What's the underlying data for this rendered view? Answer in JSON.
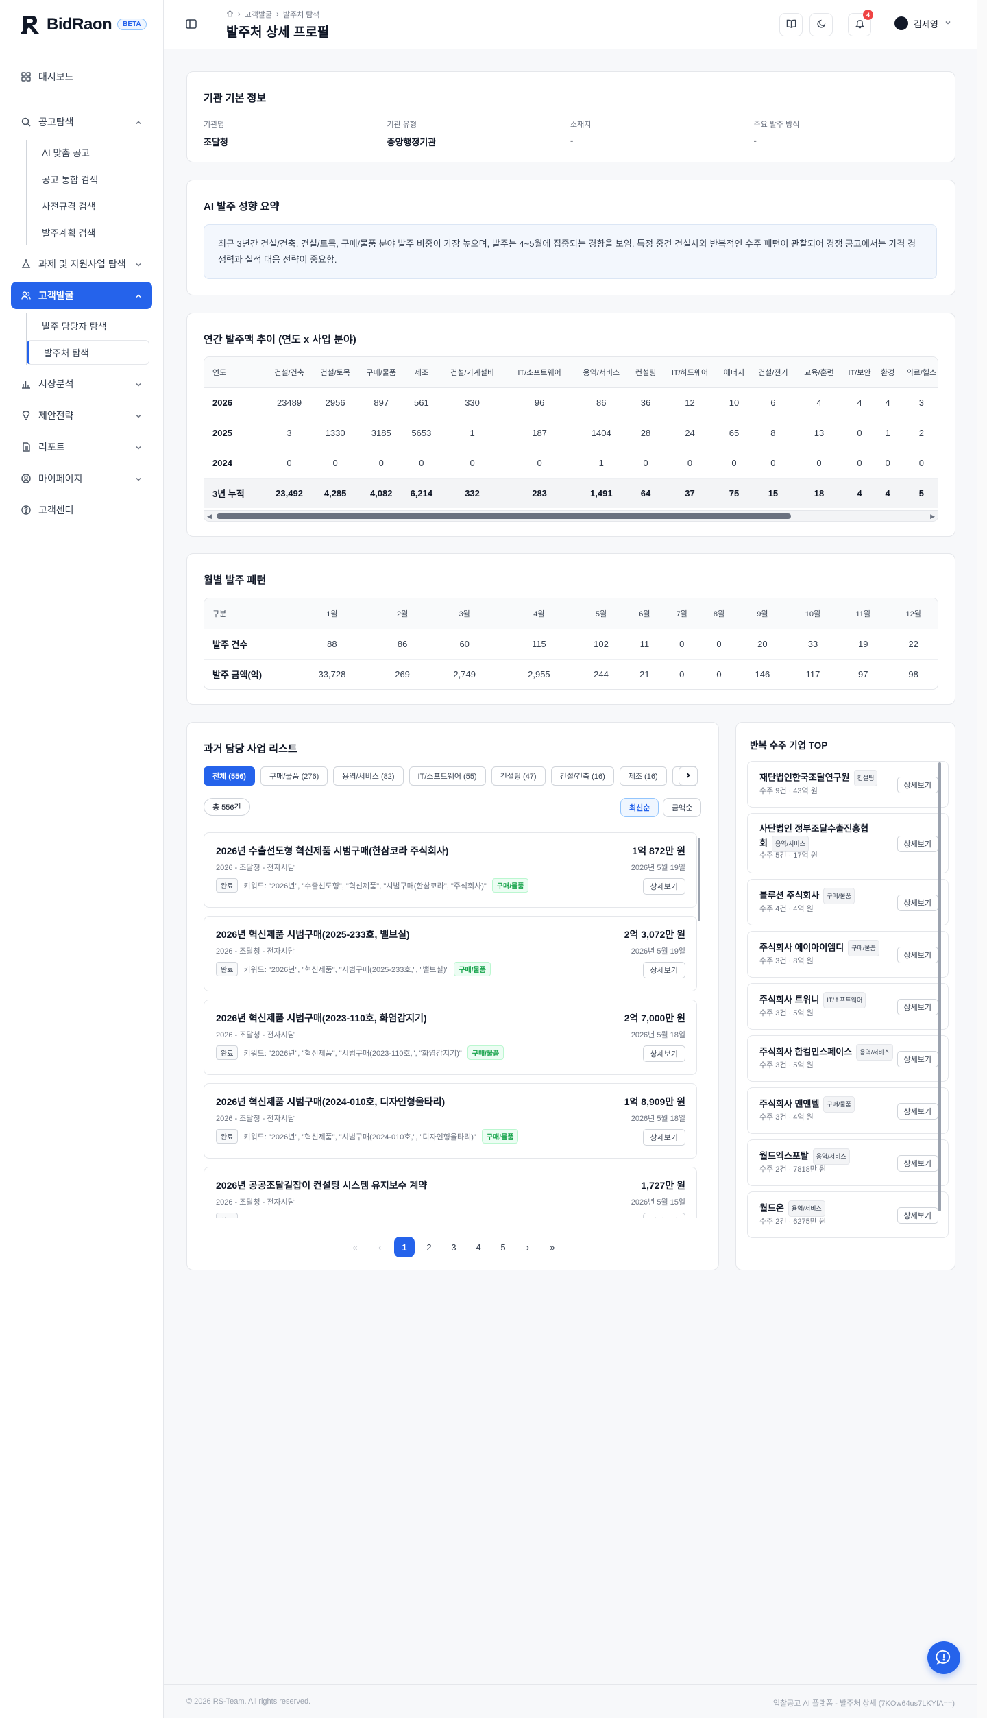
{
  "brand": {
    "name": "BidRaon",
    "badge": "BETA"
  },
  "sidebar": {
    "dashboard": "대시보드",
    "notice": "공고탐색",
    "notice_sub": [
      "AI 맞춤 공고",
      "공고 통합 검색",
      "사전규격 검색",
      "발주계획 검색"
    ],
    "grant": "과제 및 지원사업 탐색",
    "customer": "고객발굴",
    "customer_sub": [
      "발주 담당자 탐색",
      "발주처 탐색"
    ],
    "market": "시장분석",
    "proposal": "제안전략",
    "report": "리포트",
    "mypage": "마이페이지",
    "support": "고객센터"
  },
  "header": {
    "breadcrumb": [
      "고객발굴",
      "발주처 탐색"
    ],
    "title": "발주처 상세 프로필",
    "notif_count": "4",
    "user": "김세영"
  },
  "basic_info": {
    "title": "기관 기본 정보",
    "fields": [
      {
        "label": "기관명",
        "value": "조달청"
      },
      {
        "label": "기관 유형",
        "value": "중앙행정기관"
      },
      {
        "label": "소재지",
        "value": "-"
      },
      {
        "label": "주요 발주 방식",
        "value": "-"
      }
    ]
  },
  "ai_summary": {
    "title": "AI 발주 성향 요약",
    "text": "최근 3년간 건설/건축, 건설/토목, 구매/물품 분야 발주 비중이 가장 높으며, 발주는 4~5월에 집중되는 경향을 보임. 특정 중견 건설사와 반복적인 수주 패턴이 관찰되어 경쟁 공고에서는 가격 경쟁력과 실적 대응 전략이 중요함."
  },
  "annual": {
    "title": "연간 발주액 추이 (연도 x 사업 분야)",
    "headers": [
      "연도",
      "건설/건축",
      "건설/토목",
      "구매/물품",
      "제조",
      "건설/기계설비",
      "IT/소프트웨어",
      "용역/서비스",
      "컨설팅",
      "IT/하드웨어",
      "에너지",
      "건설/전기",
      "교육/훈련",
      "IT/보안",
      "환경",
      "의료/헬스"
    ],
    "rows": [
      [
        "2026",
        "23489",
        "2956",
        "897",
        "561",
        "330",
        "96",
        "86",
        "36",
        "12",
        "10",
        "6",
        "4",
        "4",
        "4",
        "3"
      ],
      [
        "2025",
        "3",
        "1330",
        "3185",
        "5653",
        "1",
        "187",
        "1404",
        "28",
        "24",
        "65",
        "8",
        "13",
        "0",
        "1",
        "2"
      ],
      [
        "2024",
        "0",
        "0",
        "0",
        "0",
        "0",
        "0",
        "1",
        "0",
        "0",
        "0",
        "0",
        "0",
        "0",
        "0",
        "0"
      ]
    ],
    "total": [
      "3년 누적",
      "23,492",
      "4,285",
      "4,082",
      "6,214",
      "332",
      "283",
      "1,491",
      "64",
      "37",
      "75",
      "15",
      "18",
      "4",
      "4",
      "5"
    ]
  },
  "monthly": {
    "title": "월별 발주 패턴",
    "headers": [
      "구분",
      "1월",
      "2월",
      "3월",
      "4월",
      "5월",
      "6월",
      "7월",
      "8월",
      "9월",
      "10월",
      "11월",
      "12월"
    ],
    "rows": [
      [
        "발주 건수",
        "88",
        "86",
        "60",
        "115",
        "102",
        "11",
        "0",
        "0",
        "20",
        "33",
        "19",
        "22"
      ],
      [
        "발주 금액(억)",
        "33,728",
        "269",
        "2,749",
        "2,955",
        "244",
        "21",
        "0",
        "0",
        "146",
        "117",
        "97",
        "98"
      ]
    ]
  },
  "projects": {
    "title": "과거 담당 사업 리스트",
    "tabs": [
      "전체 (556)",
      "구매/물품 (276)",
      "용역/서비스 (82)",
      "IT/소프트웨어 (55)",
      "컨설팅 (47)",
      "건설/건축 (16)",
      "제조 (16)",
      "건"
    ],
    "count": "총 556건",
    "sort": [
      "최신순",
      "금액순"
    ],
    "status_label": "완료",
    "detail_label": "상세보기",
    "items": [
      {
        "title": "2026년 수출선도형 혁신제품 시범구매(한삼코라 주식회사)",
        "sub": "2026 - 조달청 - 전자시담",
        "amount": "1억 872만 원",
        "date": "2026년 5월 19일",
        "keywords": "키워드: \"2026년\", \"수출선도형\", \"혁신제품\", \"시범구매(한삼코라\", \"주식회사)\"",
        "category": "구매/물품"
      },
      {
        "title": "2026년 혁신제품 시범구매(2025-233호, 밸브실)",
        "sub": "2026 - 조달청 - 전자시담",
        "amount": "2억 3,072만 원",
        "date": "2026년 5월 19일",
        "keywords": "키워드: \"2026년\", \"혁신제품\", \"시범구매(2025-233호,\", \"밸브실)\"",
        "category": "구매/물품"
      },
      {
        "title": "2026년 혁신제품 시범구매(2023-110호, 화염감지기)",
        "sub": "2026 - 조달청 - 전자시담",
        "amount": "2억 7,000만 원",
        "date": "2026년 5월 18일",
        "keywords": "키워드: \"2026년\", \"혁신제품\", \"시범구매(2023-110호,\", \"화염감지기)\"",
        "category": "구매/물품"
      },
      {
        "title": "2026년 혁신제품 시범구매(2024-010호, 디자인형울타리)",
        "sub": "2026 - 조달청 - 전자시담",
        "amount": "1억 8,909만 원",
        "date": "2026년 5월 18일",
        "keywords": "키워드: \"2026년\", \"혁신제품\", \"시범구매(2024-010호,\", \"디자인형울타리)\"",
        "category": "구매/물품"
      },
      {
        "title": "2026년 공공조달길잡이 컨설팅 시스템 유지보수 계약",
        "sub": "2026 - 조달청 - 전자시담",
        "amount": "1,727만 원",
        "date": "2026년 5월 15일",
        "keywords": "",
        "category": ""
      }
    ],
    "pages": [
      "1",
      "2",
      "3",
      "4",
      "5"
    ]
  },
  "top_companies": {
    "title": "반복 수주 기업 TOP",
    "detail_label": "상세보기",
    "items": [
      {
        "name": "재단법인한국조달연구원",
        "tag": "컨설팅",
        "meta": "수주 9건 · 43억 원"
      },
      {
        "name": "사단법인 정부조달수출진흥협회",
        "tag": "용역/서비스",
        "meta": "수주 5건 · 17억 원"
      },
      {
        "name": "블루션 주식회사",
        "tag": "구매/물품",
        "meta": "수주 4건 · 4억 원"
      },
      {
        "name": "주식회사 에이아이엠디",
        "tag": "구매/물품",
        "meta": "수주 3건 · 8억 원"
      },
      {
        "name": "주식회사 트위니",
        "tag": "IT/소프트웨어",
        "meta": "수주 3건 · 5억 원"
      },
      {
        "name": "주식회사 한컴인스페이스",
        "tag": "용역/서비스",
        "meta": "수주 3건 · 5억 원"
      },
      {
        "name": "주식회사 맨엔텔",
        "tag": "구매/물품",
        "meta": "수주 3건 · 4억 원"
      },
      {
        "name": "월드엑스포탈",
        "tag": "용역/서비스",
        "meta": "수주 2건 · 7818만 원"
      },
      {
        "name": "월드온",
        "tag": "용역/서비스",
        "meta": "수주 2건 · 6275만 원"
      }
    ]
  },
  "footer": {
    "left": "© 2026 RS-Team. All rights reserved.",
    "right": "입찰공고 AI 플랫폼 - 발주처 상세 (7KOw64us7LKYfA==)"
  }
}
